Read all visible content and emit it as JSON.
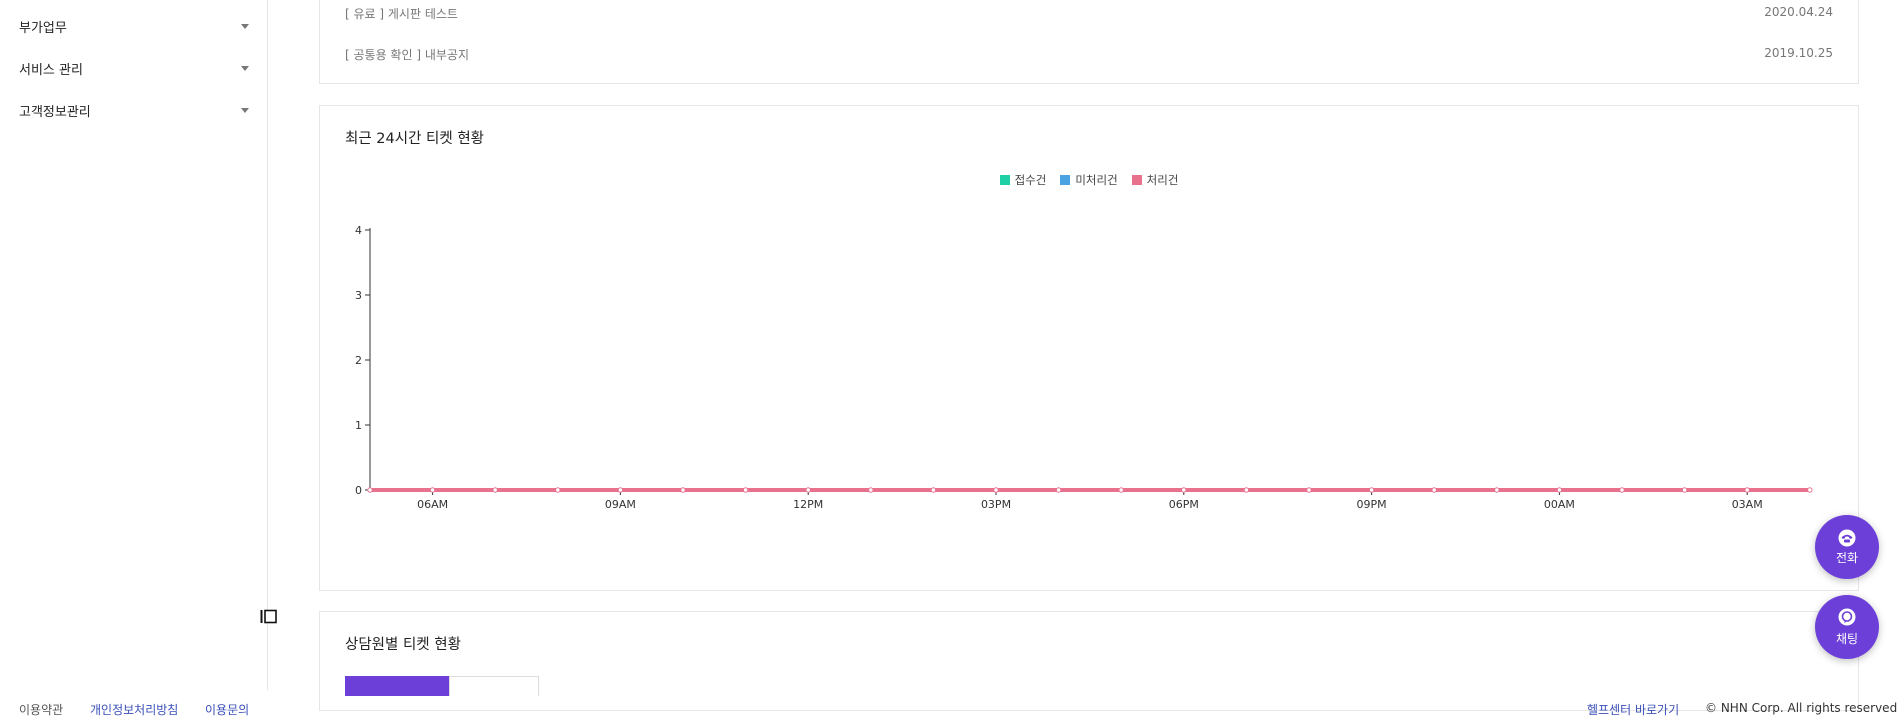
{
  "sidebar": {
    "items": [
      {
        "label": "부가업무"
      },
      {
        "label": "서비스 관리"
      },
      {
        "label": "고객정보관리"
      }
    ]
  },
  "notices": {
    "rows": [
      {
        "title": "[ 유료 ] 게시판 테스트",
        "date": "2020.04.24"
      },
      {
        "title": "[ 공통용 확인 ] 내부공지",
        "date": "2019.10.25"
      }
    ]
  },
  "ticket_chart": {
    "title": "최근 24시간 티켓 현황",
    "legend": [
      {
        "label": "접수건",
        "color": "#1fcfa6"
      },
      {
        "label": "미처리건",
        "color": "#4aa3e0"
      },
      {
        "label": "처리건",
        "color": "#e8718d"
      }
    ]
  },
  "chart_data": {
    "type": "line",
    "title": "최근 24시간 티켓 현황",
    "x_tick_labels": [
      "06AM",
      "09AM",
      "12PM",
      "03PM",
      "06PM",
      "09PM",
      "00AM",
      "03AM"
    ],
    "y_tick_labels": [
      "0",
      "1",
      "2",
      "3",
      "4"
    ],
    "ylim": [
      0,
      4
    ],
    "series": [
      {
        "name": "접수건",
        "values": [
          0,
          0,
          0,
          0,
          0,
          0,
          0,
          0,
          0,
          0,
          0,
          0,
          0,
          0,
          0,
          0,
          0,
          0,
          0,
          0,
          0,
          0,
          0,
          0
        ]
      },
      {
        "name": "미처리건",
        "values": [
          0,
          0,
          0,
          0,
          0,
          0,
          0,
          0,
          0,
          0,
          0,
          0,
          0,
          0,
          0,
          0,
          0,
          0,
          0,
          0,
          0,
          0,
          0,
          0
        ]
      },
      {
        "name": "처리건",
        "values": [
          0,
          0,
          0,
          0,
          0,
          0,
          0,
          0,
          0,
          0,
          0,
          0,
          0,
          0,
          0,
          0,
          0,
          0,
          0,
          0,
          0,
          0,
          0,
          0
        ]
      }
    ],
    "legend_position": "top-center",
    "grid": false
  },
  "agent_section": {
    "title": "상담원별 티켓 현황"
  },
  "floating": {
    "phone_label": "전화",
    "chat_label": "채팅",
    "color": "#6c3fd8"
  },
  "footer": {
    "terms": "이용약관",
    "privacy": "개인정보처리방침",
    "inquiry": "이용문의",
    "helpcenter": "헬프센터 바로가기",
    "copyright": "© NHN Corp. All rights reserved"
  }
}
